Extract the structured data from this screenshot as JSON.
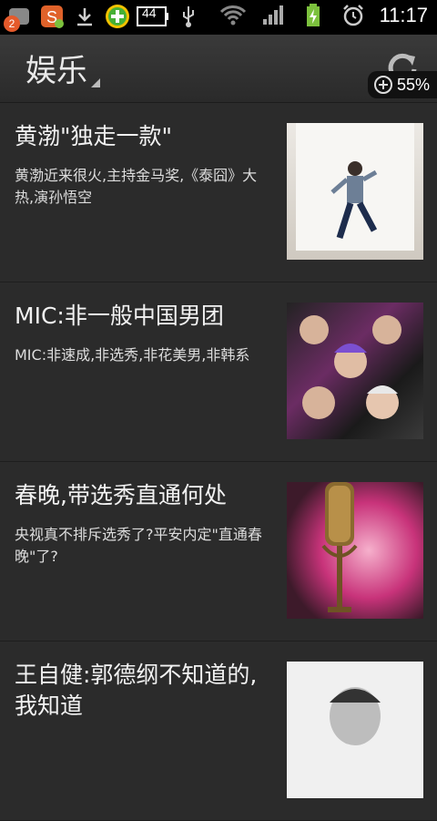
{
  "statusbar": {
    "notif_count": "2",
    "battery_level": "44",
    "time": "11:17"
  },
  "header": {
    "title": "娱乐",
    "zoom": "55%"
  },
  "articles": [
    {
      "title": "黄渤\"独走一款\"",
      "desc": "黄渤近来很火,主持金马奖,《泰囧》大热,演孙悟空"
    },
    {
      "title": "MIC:非一般中国男团",
      "desc": "MIC:非速成,非选秀,非花美男,非韩系"
    },
    {
      "title": "春晚,带选秀直通何处",
      "desc": "央视真不排斥选秀了?平安内定\"直通春晚\"了?"
    },
    {
      "title": "王自健:郭德纲不知道的,我知道",
      "desc": ""
    }
  ],
  "colors": {
    "background": "#2b2b2b",
    "statusbar": "#000000"
  }
}
